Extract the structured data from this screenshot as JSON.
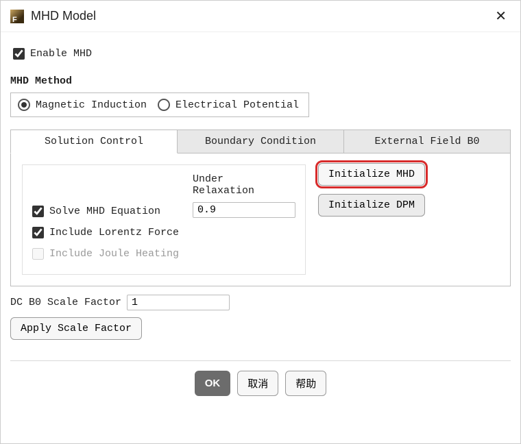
{
  "title": "MHD Model",
  "enable_mhd_label": "Enable MHD",
  "method_section": "MHD Method",
  "method": {
    "magnetic": "Magnetic Induction",
    "electrical": "Electrical Potential",
    "selected": "magnetic"
  },
  "tabs": {
    "t0": "Solution Control",
    "t1": "Boundary Condition",
    "t2": "External Field B0"
  },
  "solution": {
    "under_relax_label": "Under\nRelaxation",
    "under_relax_value": "0.9",
    "solve_mhd": "Solve MHD Equation",
    "lorentz": "Include Lorentz Force",
    "joule": "Include Joule Heating"
  },
  "buttons": {
    "init_mhd": "Initialize MHD",
    "init_dpm": "Initialize DPM",
    "apply_scale": "Apply Scale Factor"
  },
  "scale": {
    "label": "DC B0 Scale Factor",
    "value": "1"
  },
  "footer": {
    "ok": "OK",
    "cancel": "取消",
    "help": "帮助"
  }
}
